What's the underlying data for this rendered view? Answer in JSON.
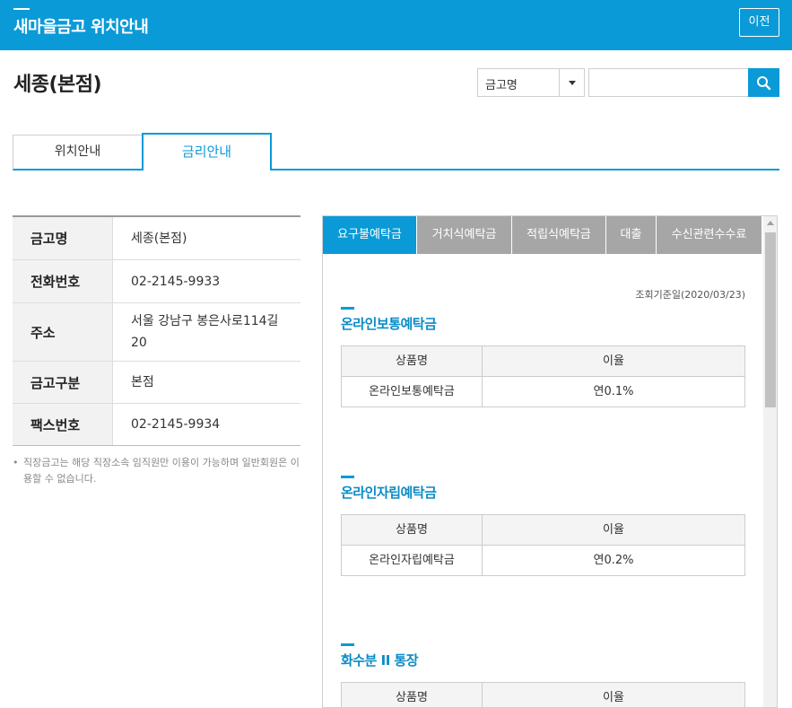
{
  "header": {
    "title": "새마을금고 위치안내",
    "back_label": "이전"
  },
  "branch": {
    "name": "세종(본점)"
  },
  "search": {
    "select_value": "금고명",
    "input_value": ""
  },
  "tabs": [
    {
      "label": "위치안내"
    },
    {
      "label": "금리안내"
    }
  ],
  "info": {
    "rows": [
      {
        "label": "금고명",
        "value": "세종(본점)"
      },
      {
        "label": "전화번호",
        "value": "02-2145-9933"
      },
      {
        "label": "주소",
        "value": "서울 강남구 봉은사로114길 20"
      },
      {
        "label": "금고구분",
        "value": "본점"
      },
      {
        "label": "팩스번호",
        "value": "02-2145-9934"
      }
    ],
    "note": "직장금고는 해당 직장소속 임직원만 이용이 가능하며 일반회원은 이용할 수 없습니다."
  },
  "rates": {
    "sub_tabs": [
      {
        "label": "요구불예탁금"
      },
      {
        "label": "거치식예탁금"
      },
      {
        "label": "적립식예탁금"
      },
      {
        "label": "대출"
      },
      {
        "label": "수신관련수수료"
      }
    ],
    "ref_date": "조회기준일(2020/03/23)",
    "col_product": "상품명",
    "col_rate": "이율",
    "sections": [
      {
        "title": "온라인보통예탁금",
        "rows": [
          {
            "product": "온라인보통예탁금",
            "rate": "연0.1%"
          }
        ]
      },
      {
        "title": "온라인자립예탁금",
        "rows": [
          {
            "product": "온라인자립예탁금",
            "rate": "연0.2%"
          }
        ]
      },
      {
        "title": "화수분 II 통장",
        "rows": []
      }
    ]
  },
  "colors": {
    "accent": "#0a9ad7",
    "inactive_tab": "#a6a6a6"
  }
}
